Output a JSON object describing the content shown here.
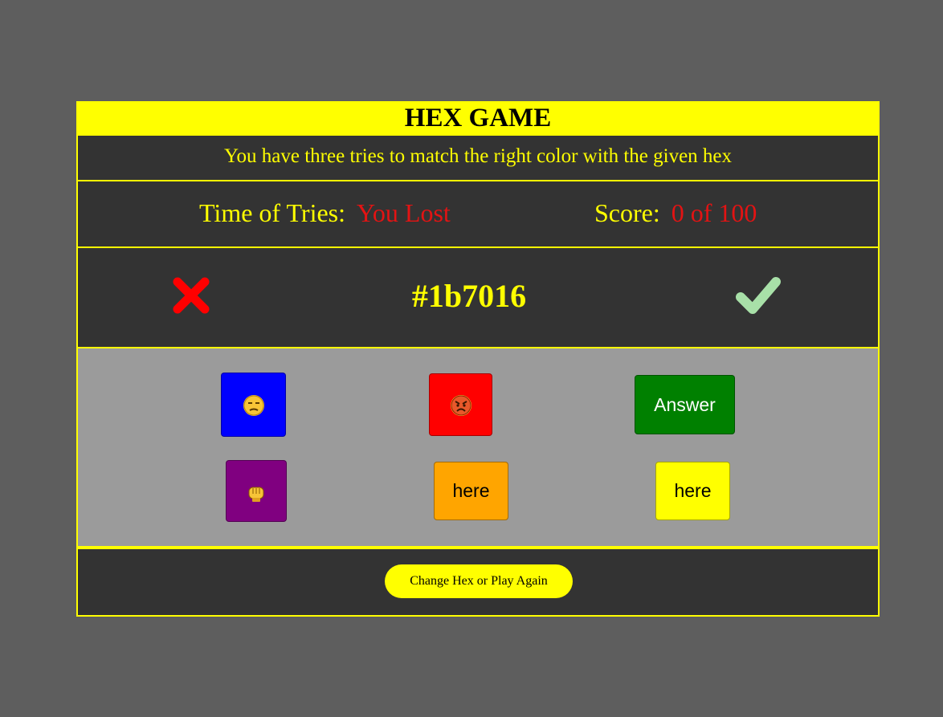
{
  "game": {
    "title": "HEX GAME",
    "subtitle": "You have three tries to match the right color with the given hex",
    "stats": {
      "tries_label": "Time of Tries:",
      "tries_value": "You Lost",
      "score_label": "Score:",
      "score_value": "0 of 100"
    },
    "hex": "#1b7016",
    "choices": [
      {
        "color": "#0000ff",
        "label": "",
        "icon": "unamused-face-emoji"
      },
      {
        "color": "#ff0000",
        "label": "",
        "icon": "angry-face-emoji"
      },
      {
        "color": "#008000",
        "label": "Answer",
        "icon": ""
      },
      {
        "color": "#800080",
        "label": "",
        "icon": "fist-bump-emoji"
      },
      {
        "color": "#ffa500",
        "label": "here",
        "icon": ""
      },
      {
        "color": "#ffff00",
        "label": "here",
        "icon": ""
      }
    ],
    "play_again_label": "Change Hex or Play Again"
  },
  "colors": {
    "background": "#5e5e5e",
    "accent": "#ffff00",
    "panel": "#333333",
    "choices_panel": "#9b9b9b",
    "error": "#e31313",
    "wrong_icon": "#ff0000",
    "right_icon": "#a8e0a8"
  }
}
